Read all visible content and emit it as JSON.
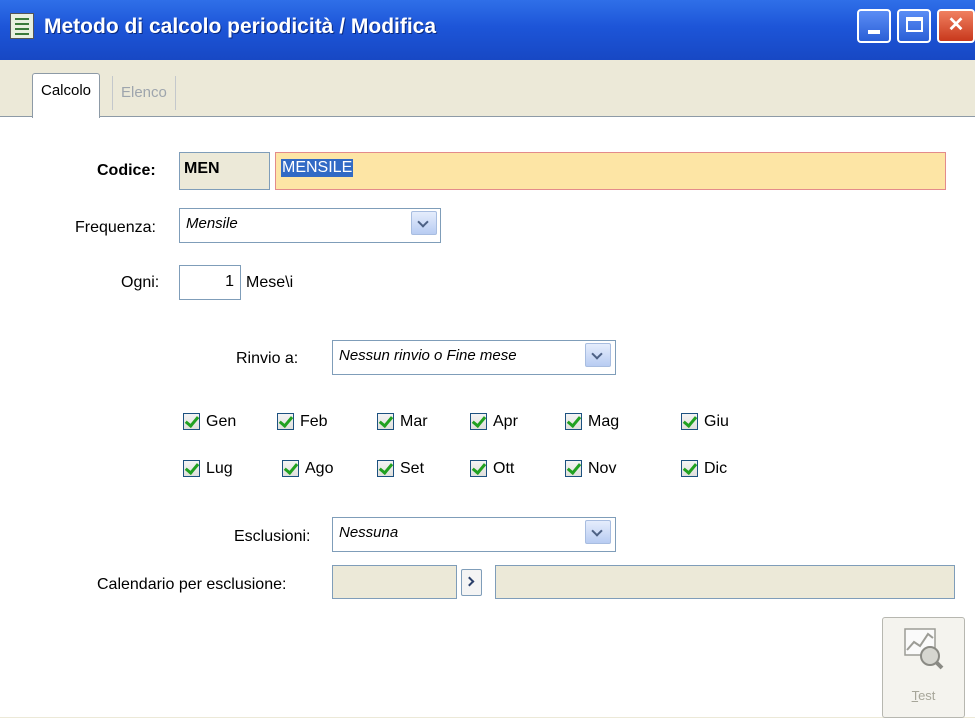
{
  "window": {
    "title": "Metodo di calcolo periodicità / Modifica",
    "buttons": {
      "minimize": "minimize-icon",
      "maximize": "maximize-icon",
      "close": "close-icon"
    }
  },
  "tabs": [
    {
      "label": "Calcolo",
      "active": true
    },
    {
      "label": "Elenco",
      "active": false
    }
  ],
  "form": {
    "codice_label": "Codice:",
    "codice_value": "MEN",
    "descrizione_value": "MENSILE",
    "frequenza_label": "Frequenza:",
    "frequenza_value": "Mensile",
    "ogni_label": "Ogni:",
    "ogni_value": "1",
    "ogni_unit": "Mese\\i",
    "rinvio_label": "Rinvio a:",
    "rinvio_value": "Nessun rinvio o Fine mese",
    "esclusioni_label": "Esclusioni:",
    "esclusioni_value": "Nessuna",
    "calendario_label": "Calendario per esclusione:",
    "calendario_code": "",
    "calendario_desc": ""
  },
  "months": [
    {
      "label": "Gen",
      "checked": true
    },
    {
      "label": "Feb",
      "checked": true
    },
    {
      "label": "Mar",
      "checked": true
    },
    {
      "label": "Apr",
      "checked": true
    },
    {
      "label": "Mag",
      "checked": true
    },
    {
      "label": "Giu",
      "checked": true
    },
    {
      "label": "Lug",
      "checked": true
    },
    {
      "label": "Ago",
      "checked": true
    },
    {
      "label": "Set",
      "checked": true
    },
    {
      "label": "Ott",
      "checked": true
    },
    {
      "label": "Nov",
      "checked": true
    },
    {
      "label": "Dic",
      "checked": true
    }
  ],
  "test_button": {
    "label_first": "T",
    "label_rest": "est",
    "enabled": false
  },
  "colors": {
    "titlebar": "#1d55d8",
    "description_bg": "#fde5a5",
    "check": "#21a121"
  }
}
